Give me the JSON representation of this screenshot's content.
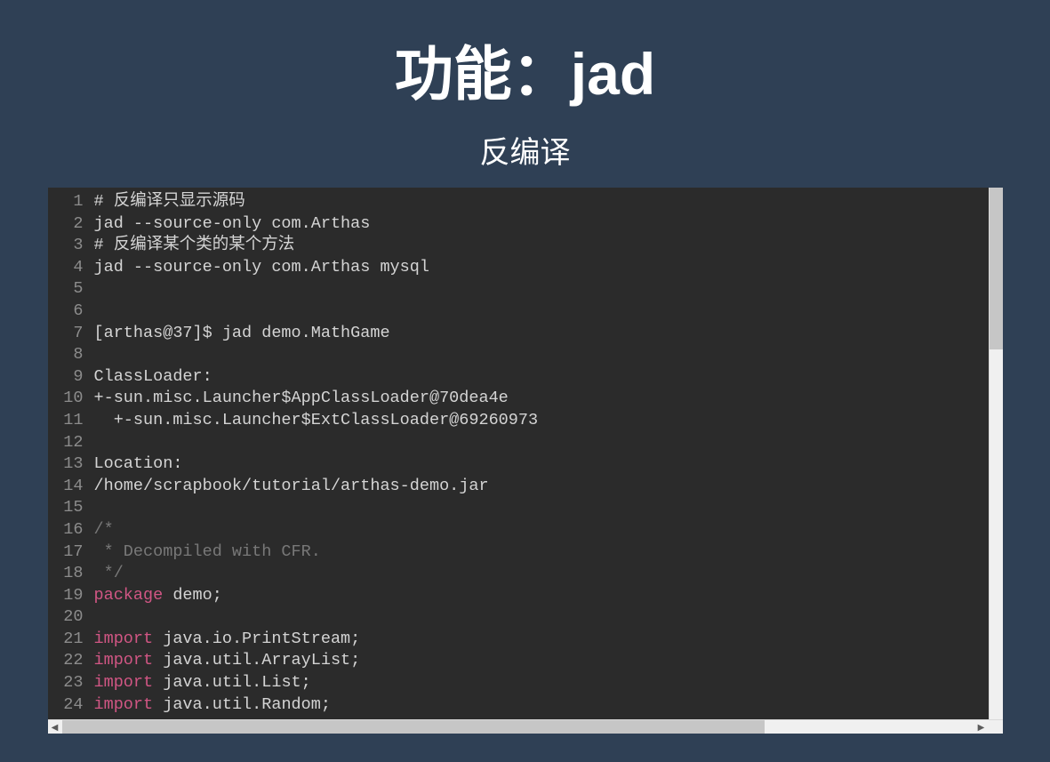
{
  "title": "功能：jad",
  "subtitle": "反编译",
  "code": {
    "lines": [
      {
        "n": 1,
        "segs": [
          {
            "t": "# 反编译只显示源码",
            "c": "txt"
          }
        ]
      },
      {
        "n": 2,
        "segs": [
          {
            "t": "jad --source-only com.Arthas",
            "c": "txt"
          }
        ]
      },
      {
        "n": 3,
        "segs": [
          {
            "t": "# 反编译某个类的某个方法",
            "c": "txt"
          }
        ]
      },
      {
        "n": 4,
        "segs": [
          {
            "t": "jad --source-only com.Arthas mysql",
            "c": "txt"
          }
        ]
      },
      {
        "n": 5,
        "segs": [
          {
            "t": "",
            "c": "txt"
          }
        ]
      },
      {
        "n": 6,
        "segs": [
          {
            "t": "",
            "c": "txt"
          }
        ]
      },
      {
        "n": 7,
        "segs": [
          {
            "t": "[arthas@37]$ jad demo.MathGame",
            "c": "txt"
          }
        ]
      },
      {
        "n": 8,
        "segs": [
          {
            "t": "",
            "c": "txt"
          }
        ]
      },
      {
        "n": 9,
        "segs": [
          {
            "t": "ClassLoader:",
            "c": "txt"
          }
        ]
      },
      {
        "n": 10,
        "segs": [
          {
            "t": "+-sun.misc.Launcher$AppClassLoader@70dea4e",
            "c": "txt"
          }
        ]
      },
      {
        "n": 11,
        "segs": [
          {
            "t": "  +-sun.misc.Launcher$ExtClassLoader@69260973",
            "c": "txt"
          }
        ]
      },
      {
        "n": 12,
        "segs": [
          {
            "t": "",
            "c": "txt"
          }
        ]
      },
      {
        "n": 13,
        "segs": [
          {
            "t": "Location:",
            "c": "txt"
          }
        ]
      },
      {
        "n": 14,
        "segs": [
          {
            "t": "/home/scrapbook/tutorial/arthas-demo.jar",
            "c": "txt"
          }
        ]
      },
      {
        "n": 15,
        "segs": [
          {
            "t": "",
            "c": "txt"
          }
        ]
      },
      {
        "n": 16,
        "segs": [
          {
            "t": "/*",
            "c": "cmt"
          }
        ]
      },
      {
        "n": 17,
        "segs": [
          {
            "t": " * Decompiled with CFR.",
            "c": "cmt"
          }
        ]
      },
      {
        "n": 18,
        "segs": [
          {
            "t": " */",
            "c": "cmt"
          }
        ]
      },
      {
        "n": 19,
        "segs": [
          {
            "t": "package",
            "c": "kw"
          },
          {
            "t": " demo;",
            "c": "txt"
          }
        ]
      },
      {
        "n": 20,
        "segs": [
          {
            "t": "",
            "c": "txt"
          }
        ]
      },
      {
        "n": 21,
        "segs": [
          {
            "t": "import",
            "c": "kw"
          },
          {
            "t": " java.io.PrintStream;",
            "c": "txt"
          }
        ]
      },
      {
        "n": 22,
        "segs": [
          {
            "t": "import",
            "c": "kw"
          },
          {
            "t": " java.util.ArrayList;",
            "c": "txt"
          }
        ]
      },
      {
        "n": 23,
        "segs": [
          {
            "t": "import",
            "c": "kw"
          },
          {
            "t": " java.util.List;",
            "c": "txt"
          }
        ]
      },
      {
        "n": 24,
        "segs": [
          {
            "t": "import",
            "c": "kw"
          },
          {
            "t": " java.util.Random;",
            "c": "txt"
          }
        ]
      }
    ]
  }
}
